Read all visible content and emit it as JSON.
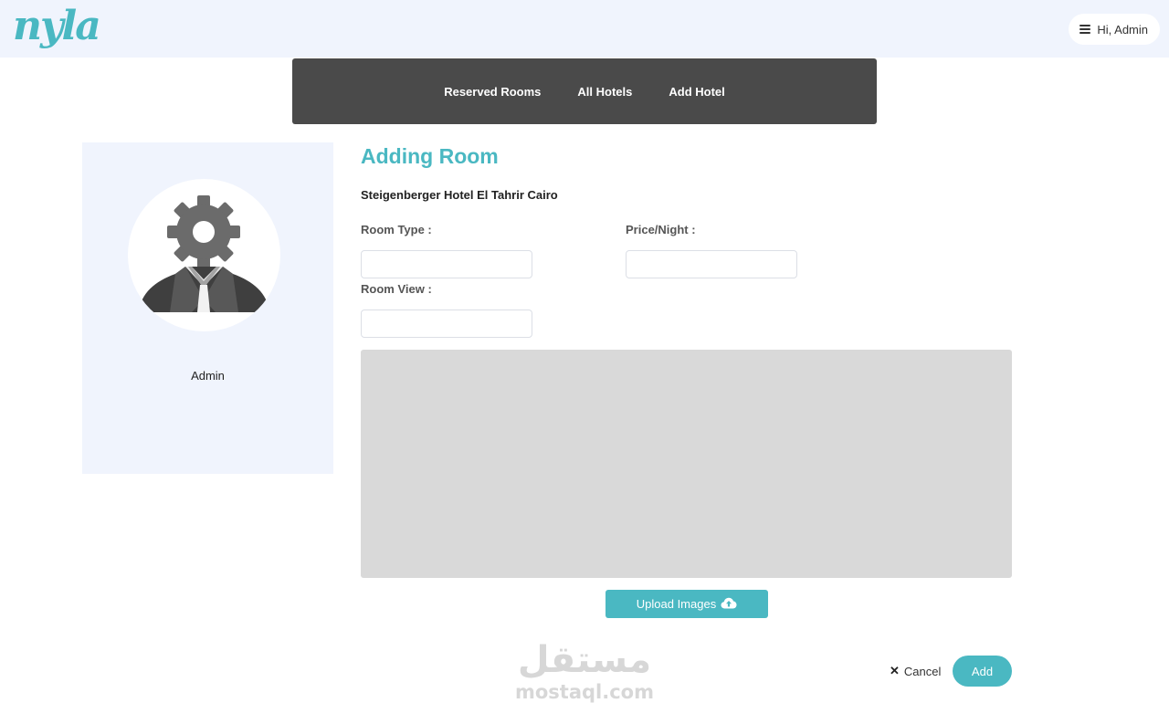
{
  "header": {
    "logo_text": "nyla",
    "user_menu_label": "Hi, Admin",
    "menu_icon": "hamburger-icon"
  },
  "nav": {
    "items": [
      {
        "label": "Reserved Rooms"
      },
      {
        "label": "All Hotels"
      },
      {
        "label": "Add Hotel"
      }
    ]
  },
  "sidebar": {
    "avatar_icon": "admin-avatar-icon",
    "name": "Admin"
  },
  "form": {
    "title": "Adding Room",
    "hotel_name": "Steigenberger Hotel El Tahrir Cairo",
    "room_type_label": "Room Type :",
    "room_type_value": "",
    "price_label": "Price/Night :",
    "price_value": "",
    "room_view_label": "Room View :",
    "room_view_value": "",
    "upload_label": "Upload Images",
    "upload_icon": "cloud-upload-icon",
    "cancel_label": "Cancel",
    "cancel_icon": "close-icon",
    "add_label": "Add"
  },
  "watermark": {
    "arabic": "مستقل",
    "latin": "mostaql.com"
  },
  "colors": {
    "accent": "#4ab8c2",
    "nav_bg": "#4a4a4a",
    "panel_bg": "#f0f4fd",
    "dropzone_bg": "#d9d9d9"
  }
}
